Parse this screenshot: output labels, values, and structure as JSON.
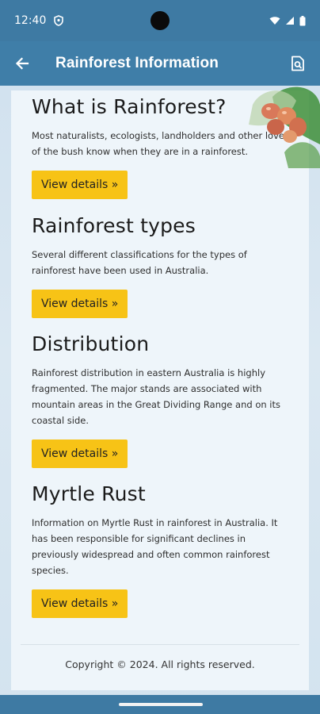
{
  "status": {
    "time": "12:40"
  },
  "app_bar": {
    "title": "Rainforest Information"
  },
  "sections": [
    {
      "title": "What is Rainforest?",
      "body": "Most naturalists, ecologists, landholders and other lovers of the bush know when they are in a rainforest.",
      "button": "View details »"
    },
    {
      "title": "Rainforest types",
      "body": "Several different classifications for the types of rainforest have been used in Australia.",
      "button": "View details »"
    },
    {
      "title": "Distribution",
      "body": "Rainforest distribution in eastern Australia is highly fragmented. The major stands are associated with mountain areas in the Great Dividing Range and on its coastal side.",
      "button": "View details »"
    },
    {
      "title": "Myrtle Rust",
      "body": "Information on Myrtle Rust in rainforest in Australia. It has been responsible for significant declines in previously widespread and often common rainforest species.",
      "button": "View details »"
    }
  ],
  "footer": {
    "copyright": "Copyright © 2024. All rights reserved."
  },
  "colors": {
    "app_bar": "#3f7ea8",
    "button": "#f7c316",
    "card": "#eef5fa"
  },
  "icons": {
    "back": "arrow-left-icon",
    "search": "find-in-page-icon"
  }
}
